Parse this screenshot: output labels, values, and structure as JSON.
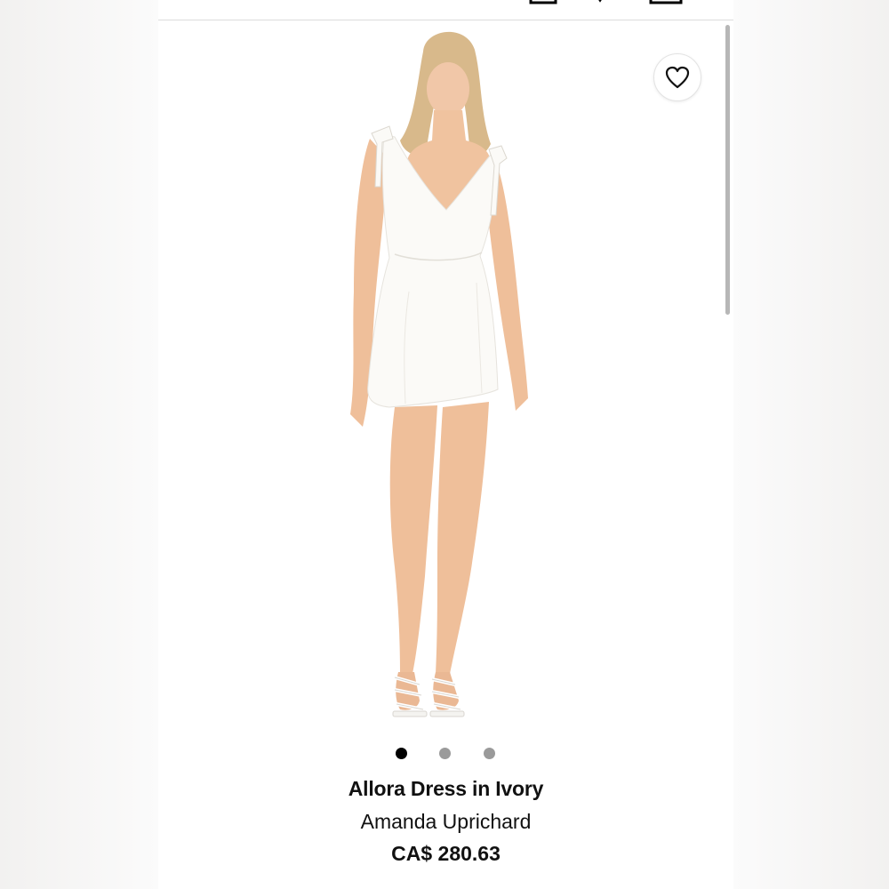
{
  "product": {
    "title": "Allora Dress in Ivory",
    "brand": "Amanda Uprichard",
    "price": "CA$ 280.63"
  },
  "gallery": {
    "image_count": 3,
    "active_index": 0,
    "image_alt": "Model wearing white mini dress with shoulder ties"
  },
  "icons": {
    "wishlist": "heart-icon",
    "search": "search-icon",
    "account": "account-icon",
    "bag": "shopping-bag-icon"
  },
  "colors": {
    "accent_link": "#c4113f",
    "dot_active": "#000000",
    "dot_inactive": "#9a9a9a"
  }
}
